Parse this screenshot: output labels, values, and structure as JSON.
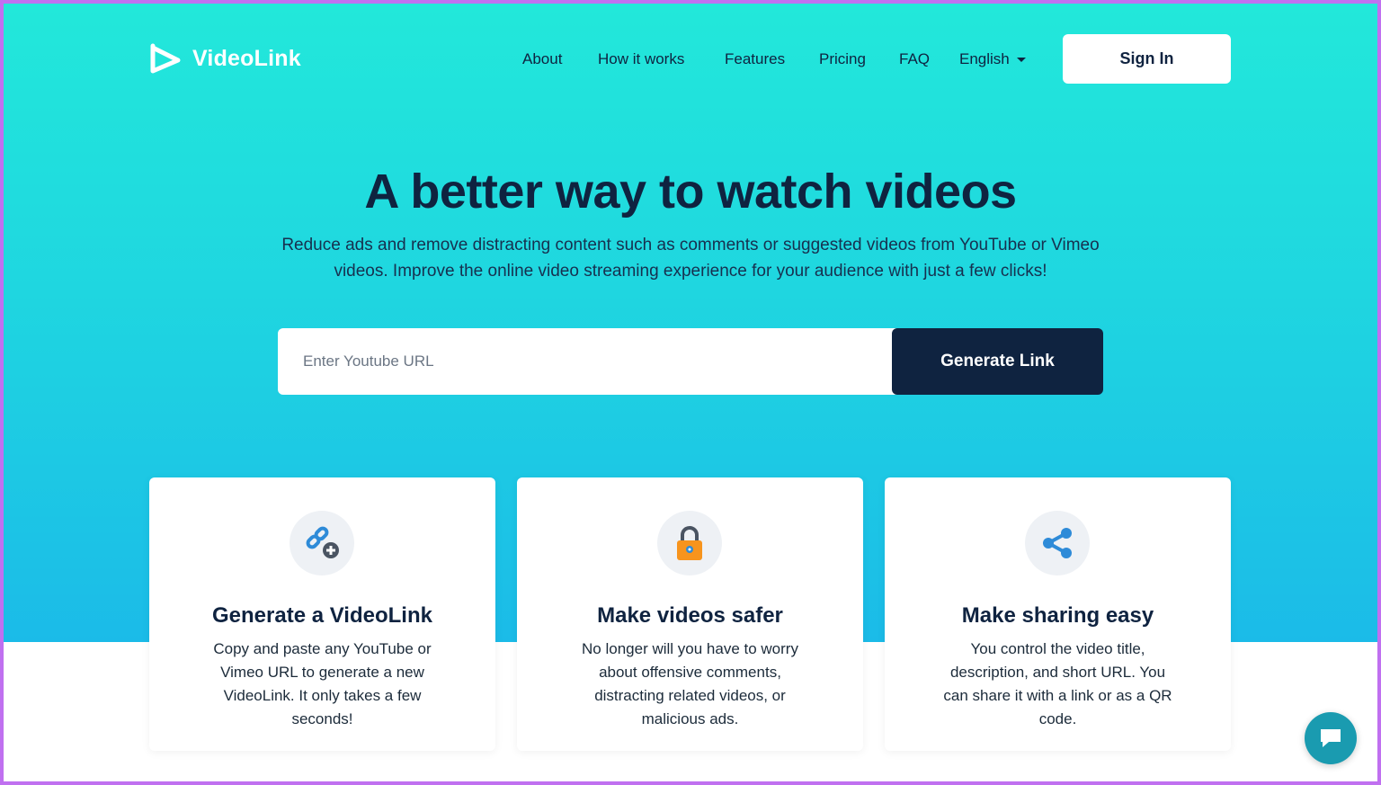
{
  "colors": {
    "hero_gradient_top": "#22e8da",
    "hero_gradient_bottom": "#1bbbe8",
    "navy": "#0f2340",
    "frame_border": "#c070f0",
    "lock_orange": "#f7941d",
    "link_blue": "#2e8bd8",
    "chat_teal": "#1a9bb0"
  },
  "brand": {
    "name": "VideoLink",
    "icon": "videolink-logo-icon"
  },
  "nav": {
    "items": [
      {
        "label": "About"
      },
      {
        "label": "How it works"
      },
      {
        "label": "Features"
      },
      {
        "label": "Pricing"
      },
      {
        "label": "FAQ"
      }
    ],
    "language": {
      "label": "English",
      "icon": "chevron-down-icon"
    },
    "signin_label": "Sign In"
  },
  "hero": {
    "title": "A better way to watch videos",
    "subtitle": "Reduce ads and remove distracting content such as comments or suggested videos from YouTube or Vimeo videos. Improve the online video streaming experience for your audience with just a few clicks!",
    "input_placeholder": "Enter Youtube URL",
    "input_value": "",
    "generate_label": "Generate Link"
  },
  "features": [
    {
      "icon": "link-add-icon",
      "title": "Generate a VideoLink",
      "text": "Copy and paste any YouTube or Vimeo URL to generate a new VideoLink. It only takes a few seconds!"
    },
    {
      "icon": "lock-icon",
      "title": "Make videos safer",
      "text": "No longer will you have to worry about offensive comments, distracting related videos, or malicious ads."
    },
    {
      "icon": "share-icon",
      "title": "Make sharing easy",
      "text": "You control the video title, description, and short URL. You can share it with a link or as a QR code."
    }
  ],
  "chat_widget": {
    "icon": "chat-bubble-icon"
  }
}
